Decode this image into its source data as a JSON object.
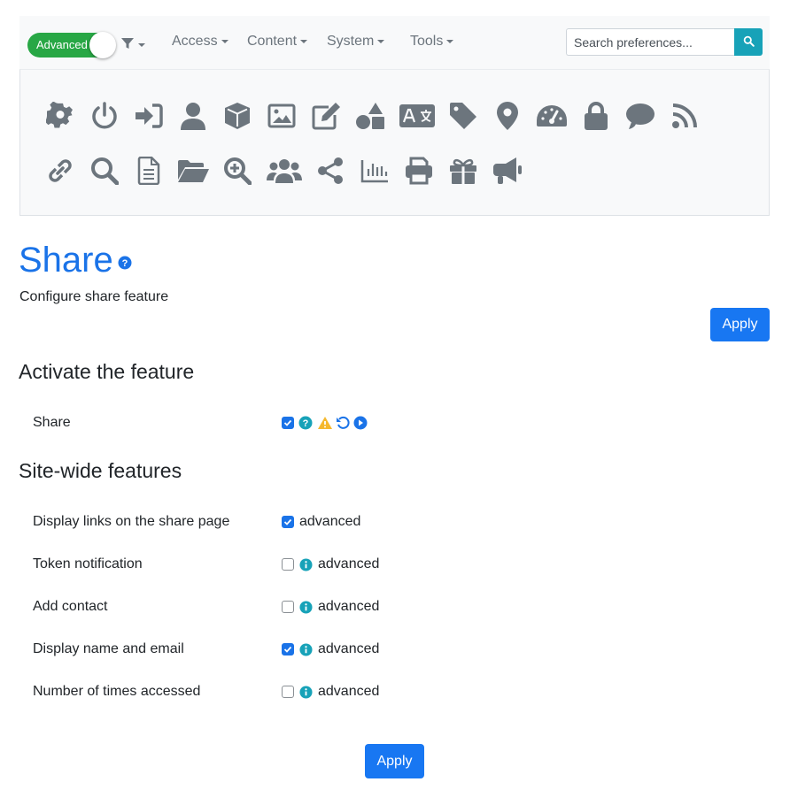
{
  "navbar": {
    "toggle_label": "Advanced",
    "menus": [
      {
        "label": "Access"
      },
      {
        "label": "Content"
      },
      {
        "label": "System"
      },
      {
        "label": "Tools"
      }
    ],
    "search": {
      "placeholder": "Search preferences..."
    }
  },
  "icon_panel": {
    "row1": [
      "gear-icon",
      "power-icon",
      "sign-in-icon",
      "user-icon",
      "cube-icon",
      "image-icon",
      "edit-icon",
      "shapes-icon",
      "language-icon",
      "tag-icon",
      "map-marker-icon",
      "tachometer-icon",
      "lock-icon",
      "comment-icon",
      "rss-icon"
    ],
    "row2": [
      "link-icon",
      "search-icon",
      "file-icon",
      "folder-open-icon",
      "zoom-in-icon",
      "users-icon",
      "share-icon",
      "chart-icon",
      "print-icon",
      "gift-icon",
      "bullhorn-icon"
    ]
  },
  "page": {
    "title": "Share",
    "description": "Configure share feature",
    "apply_label": "Apply"
  },
  "sections": {
    "activate": {
      "title": "Activate the feature",
      "pref": {
        "label": "Share",
        "checked": true
      }
    },
    "sitewide": {
      "title": "Site-wide features",
      "prefs": [
        {
          "label": "Display links on the share page",
          "checked": true,
          "tag": "advanced"
        },
        {
          "label": "Token notification",
          "checked": false,
          "tag": "advanced"
        },
        {
          "label": "Add contact",
          "checked": false,
          "tag": "advanced"
        },
        {
          "label": "Display name and email",
          "checked": true,
          "tag": "advanced"
        },
        {
          "label": "Number of times accessed",
          "checked": false,
          "tag": "advanced"
        }
      ]
    }
  },
  "colors": {
    "accent": "#1a73e8",
    "toggle": "#28a745",
    "search_btn": "#17a2b8",
    "icon": "#6c757d"
  }
}
